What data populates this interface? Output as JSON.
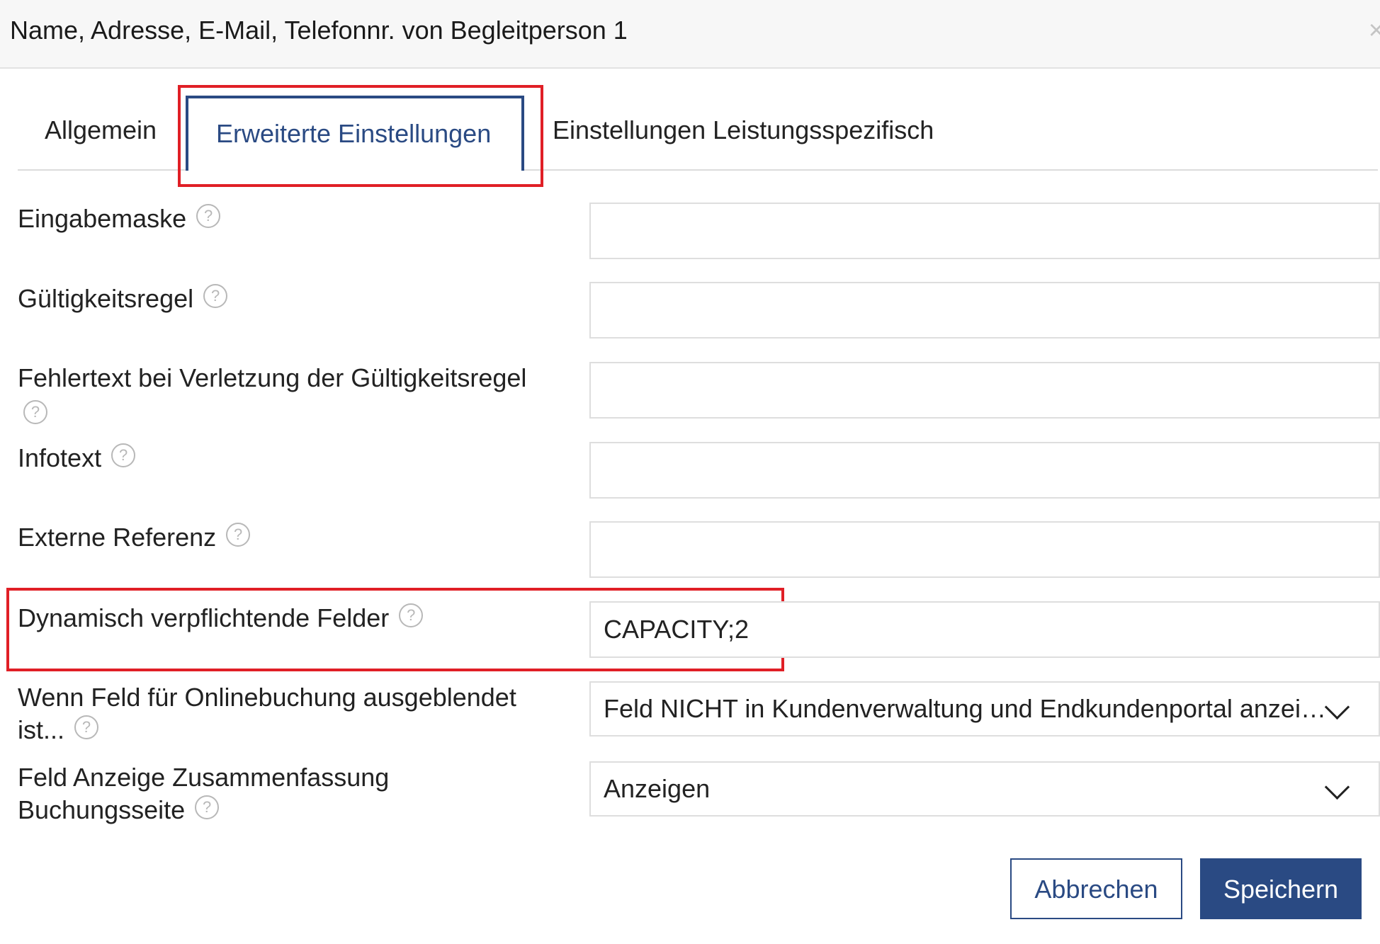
{
  "dialog": {
    "title": "Name, Adresse, E-Mail, Telefonnr. von Begleitperson 1",
    "close_symbol": "×"
  },
  "tabs": [
    {
      "label": "Allgemein",
      "active": false
    },
    {
      "label": "Erweiterte Einstellungen",
      "active": true
    },
    {
      "label": "Einstellungen Leistungsspezifisch",
      "active": false
    }
  ],
  "fields": {
    "eingabemaske": {
      "label": "Eingabemaske",
      "value": ""
    },
    "gueltigkeitsregel": {
      "label": "Gültigkeitsregel",
      "value": ""
    },
    "fehlertext": {
      "label": "Fehlertext bei Verletzung der Gültigkeitsregel",
      "value": ""
    },
    "infotext": {
      "label": "Infotext",
      "value": ""
    },
    "externe_referenz": {
      "label": "Externe Referenz",
      "value": ""
    },
    "dynamisch": {
      "label": "Dynamisch verpflichtende Felder",
      "value": "CAPACITY;2"
    },
    "online_ausgeblendet": {
      "label_line1": "Wenn Feld für Onlinebuchung ausgeblendet",
      "label_line2": "ist...",
      "value": "Feld NICHT in Kundenverwaltung und Endkundenportal anzeigen"
    },
    "anzeige_zusammenfassung": {
      "label_line1": "Feld Anzeige Zusammenfassung",
      "label_line2": "Buchungsseite",
      "value": "Anzeigen"
    }
  },
  "help_symbol": "?",
  "buttons": {
    "cancel": "Abbrechen",
    "save": "Speichern"
  },
  "colors": {
    "accent": "#2a4a83",
    "highlight": "#e01f26",
    "border": "#dedede"
  },
  "icons": [
    "close-icon",
    "help-icon",
    "chevron-down-icon"
  ]
}
